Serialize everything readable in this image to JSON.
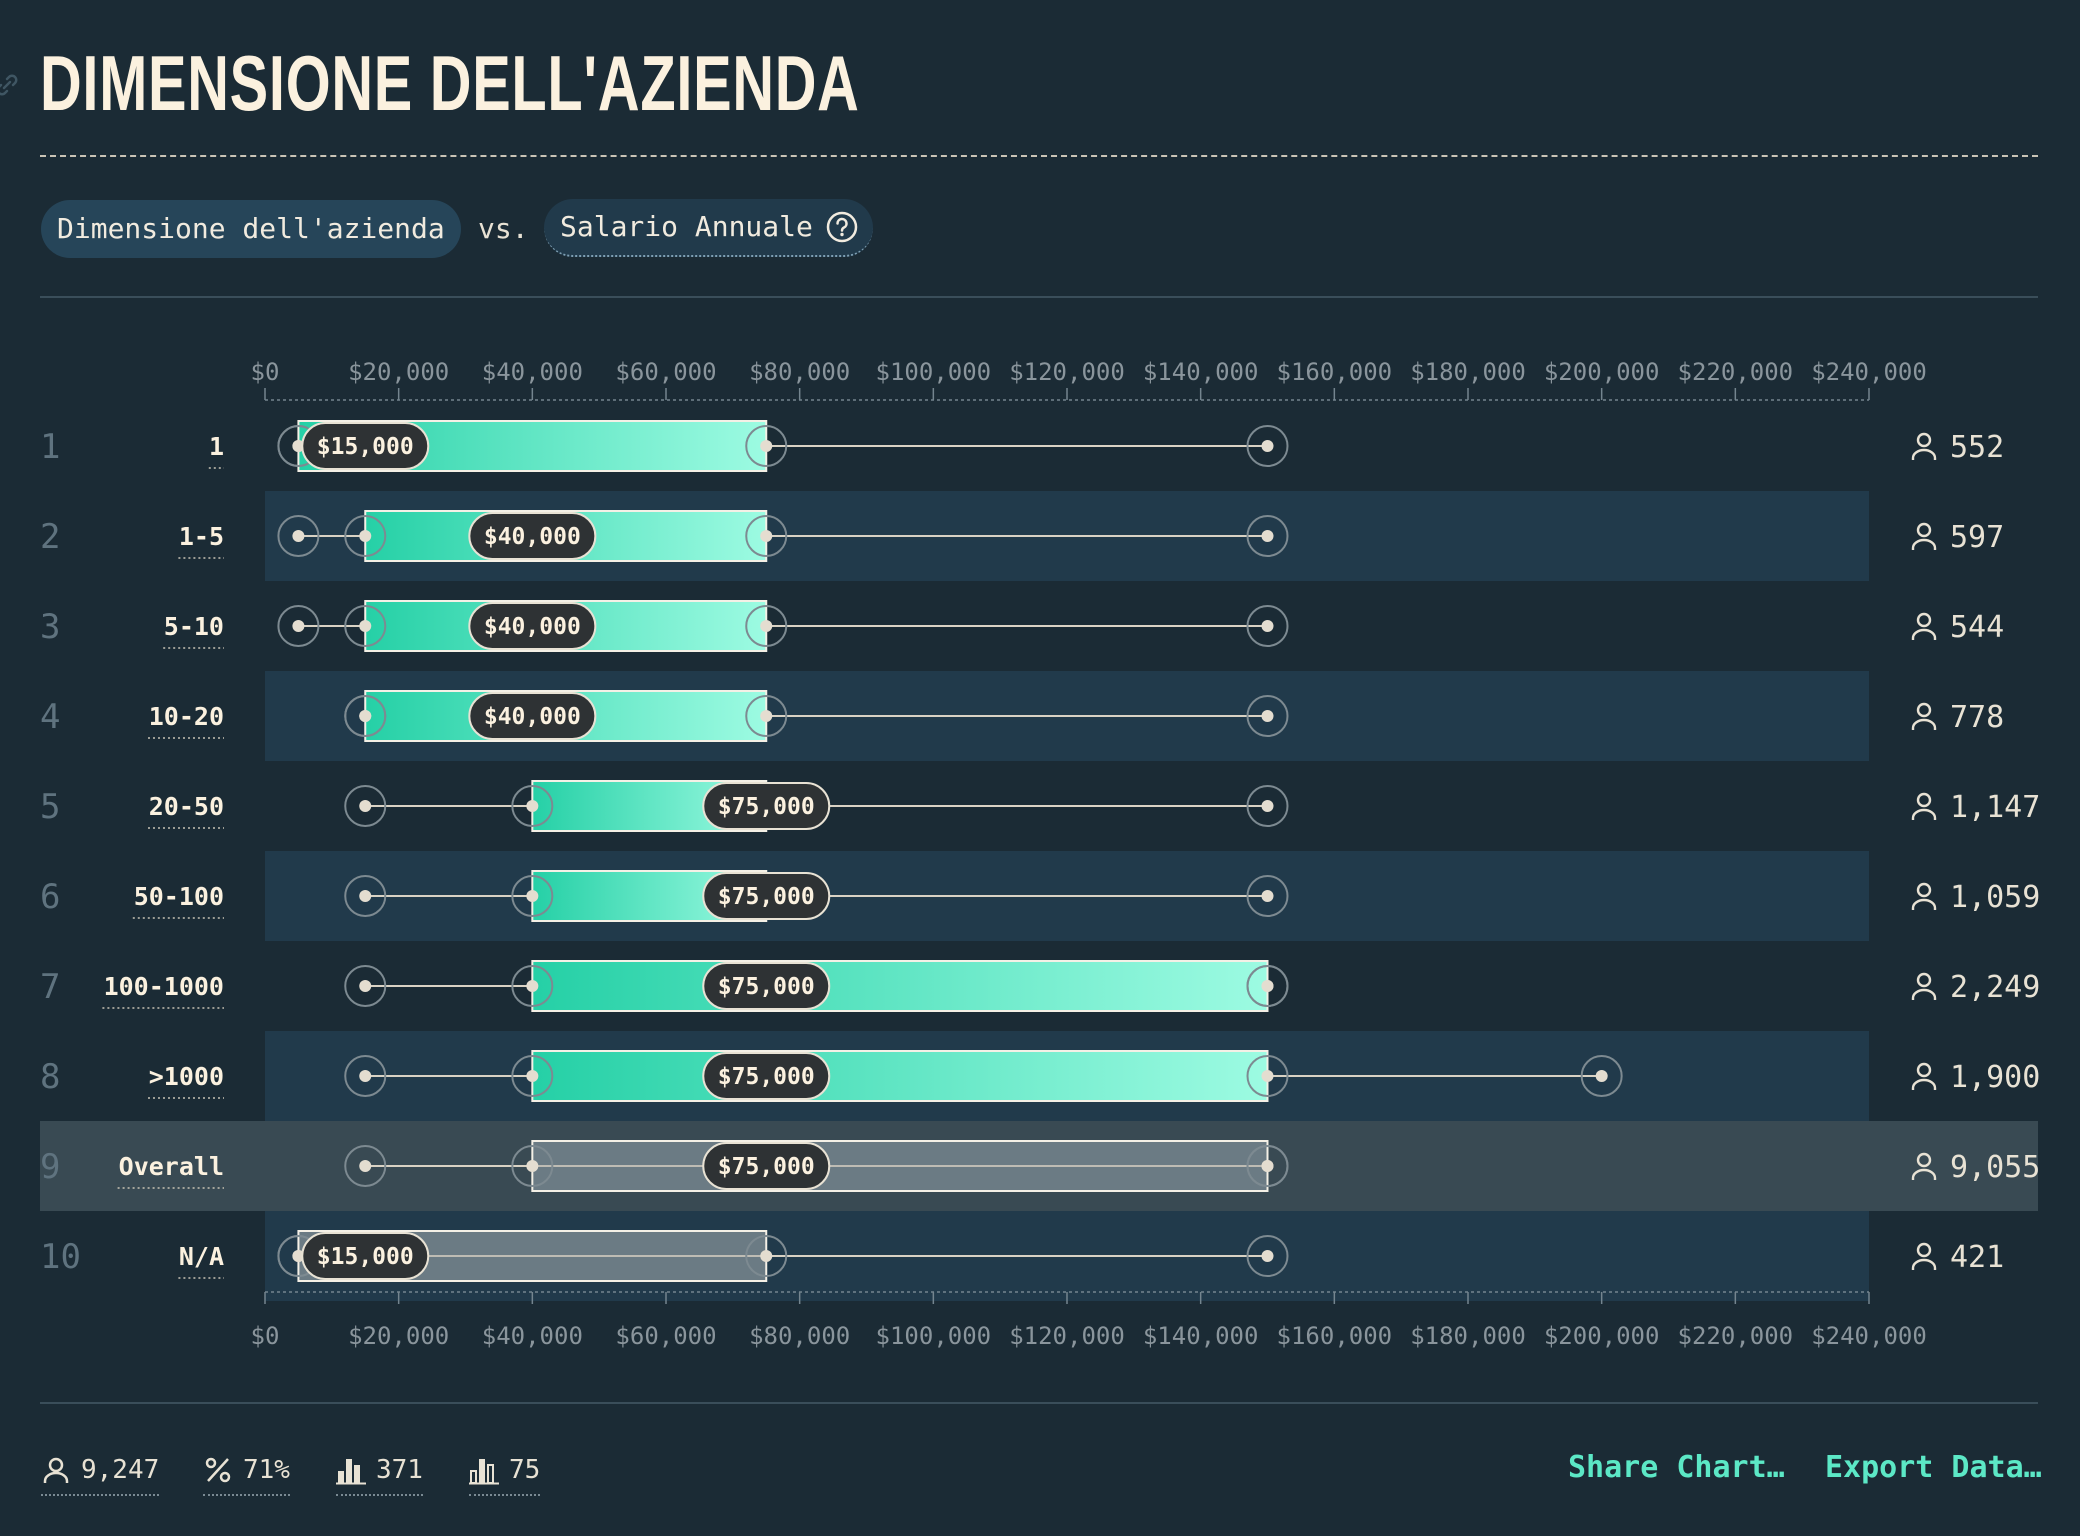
{
  "title": "DIMENSIONE DELL'AZIENDA",
  "controls": {
    "dimension_label": "Dimensione dell'azienda",
    "vs_label": "vs.",
    "metric_label": "Salario Annuale"
  },
  "chart_data": {
    "type": "box",
    "x_axis": {
      "min": 0,
      "max": 240000,
      "step": 20000,
      "tick_labels": [
        "$0",
        "$20,000",
        "$40,000",
        "$60,000",
        "$80,000",
        "$100,000",
        "$120,000",
        "$140,000",
        "$160,000",
        "$180,000",
        "$200,000",
        "$220,000",
        "$240,000"
      ]
    },
    "rows": [
      {
        "rank": "1",
        "label": "1",
        "min": 5000,
        "q1": 5000,
        "median": 15000,
        "q3": 75000,
        "max": 150000,
        "median_label": "$15,000",
        "count": "552",
        "highlight": false,
        "muted": false
      },
      {
        "rank": "2",
        "label": "1-5",
        "min": 5000,
        "q1": 15000,
        "median": 40000,
        "q3": 75000,
        "max": 150000,
        "median_label": "$40,000",
        "count": "597",
        "highlight": false,
        "muted": false
      },
      {
        "rank": "3",
        "label": "5-10",
        "min": 5000,
        "q1": 15000,
        "median": 40000,
        "q3": 75000,
        "max": 150000,
        "median_label": "$40,000",
        "count": "544",
        "highlight": false,
        "muted": false
      },
      {
        "rank": "4",
        "label": "10-20",
        "min": 15000,
        "q1": 15000,
        "median": 40000,
        "q3": 75000,
        "max": 150000,
        "median_label": "$40,000",
        "count": "778",
        "highlight": false,
        "muted": false
      },
      {
        "rank": "5",
        "label": "20-50",
        "min": 15000,
        "q1": 40000,
        "median": 75000,
        "q3": 75000,
        "max": 150000,
        "median_label": "$75,000",
        "count": "1,147",
        "highlight": false,
        "muted": false
      },
      {
        "rank": "6",
        "label": "50-100",
        "min": 15000,
        "q1": 40000,
        "median": 75000,
        "q3": 75000,
        "max": 150000,
        "median_label": "$75,000",
        "count": "1,059",
        "highlight": false,
        "muted": false
      },
      {
        "rank": "7",
        "label": "100-1000",
        "min": 15000,
        "q1": 40000,
        "median": 75000,
        "q3": 150000,
        "max": 150000,
        "median_label": "$75,000",
        "count": "2,249",
        "highlight": false,
        "muted": false
      },
      {
        "rank": "8",
        "label": ">1000",
        "min": 15000,
        "q1": 40000,
        "median": 75000,
        "q3": 150000,
        "max": 200000,
        "median_label": "$75,000",
        "count": "1,900",
        "highlight": false,
        "muted": false
      },
      {
        "rank": "9",
        "label": "Overall",
        "min": 15000,
        "q1": 40000,
        "median": 75000,
        "q3": 150000,
        "max": 150000,
        "median_label": "$75,000",
        "count": "9,055",
        "highlight": true,
        "muted": true
      },
      {
        "rank": "10",
        "label": "N/A",
        "min": 5000,
        "q1": 5000,
        "median": 15000,
        "q3": 75000,
        "max": 150000,
        "median_label": "$15,000",
        "count": "421",
        "highlight": false,
        "muted": true
      }
    ],
    "colors": {
      "box_start": "#25d0a6",
      "box_end": "#9dfbe2",
      "muted_box": "#6b7b84",
      "median_pill": "#2e3234",
      "stripe": "#213a4b",
      "highlight_row": "#394a53"
    }
  },
  "footer": {
    "respondents": "9,247",
    "percent": "71%",
    "stat_a": "371",
    "stat_b": "75",
    "share_label": "Share Chart…",
    "export_label": "Export Data…"
  }
}
